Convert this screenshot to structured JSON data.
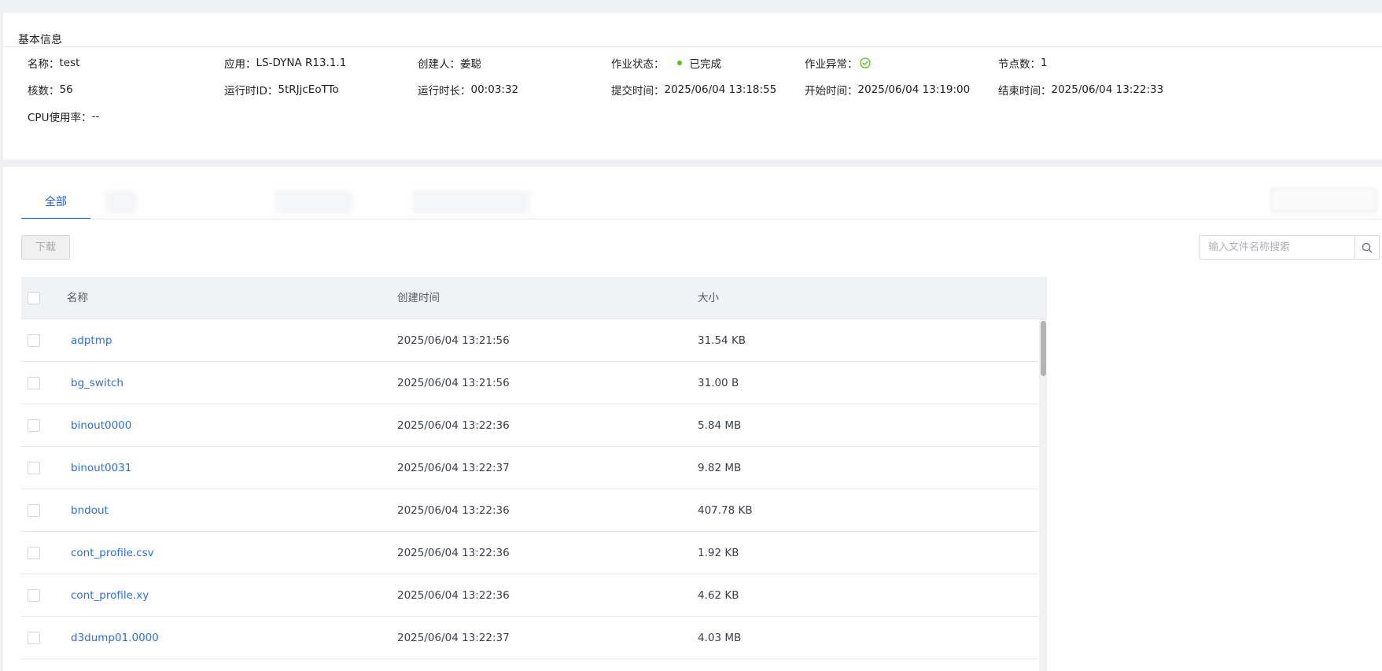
{
  "basic_info": {
    "title": "基本信息",
    "fields": {
      "name": {
        "label": "名称：",
        "value": "test"
      },
      "app": {
        "label": "应用：",
        "value": "LS-DYNA R13.1.1"
      },
      "creator": {
        "label": "创建人：",
        "value": "姜聪"
      },
      "job_status": {
        "label": "作业状态：",
        "value": "已完成"
      },
      "job_error": {
        "label": "作业异常："
      },
      "node_count": {
        "label": "节点数：",
        "value": "1"
      },
      "cores": {
        "label": "核数：",
        "value": "56"
      },
      "run_id": {
        "label": "运行时ID：",
        "value": "5tRJjcEoTTo"
      },
      "run_duration": {
        "label": "运行时长：",
        "value": "00:03:32"
      },
      "submit_time": {
        "label": "提交时间：",
        "value": "2025/06/04 13:18:55"
      },
      "start_time": {
        "label": "开始时间：",
        "value": "2025/06/04 13:19:00"
      },
      "end_time": {
        "label": "结束时间：",
        "value": "2025/06/04 13:22:33"
      },
      "cpu_usage": {
        "label": "CPU使用率：",
        "value": "--"
      }
    }
  },
  "tabs": {
    "active": "全部"
  },
  "toolbar": {
    "download_label": "下载",
    "search_placeholder": "输入文件名称搜索"
  },
  "table": {
    "columns": {
      "name": "名称",
      "created": "创建时间",
      "size": "大小"
    },
    "rows": [
      {
        "name": "adptmp",
        "created": "2025/06/04 13:21:56",
        "size": "31.54 KB"
      },
      {
        "name": "bg_switch",
        "created": "2025/06/04 13:21:56",
        "size": "31.00 B"
      },
      {
        "name": "binout0000",
        "created": "2025/06/04 13:22:36",
        "size": "5.84 MB"
      },
      {
        "name": "binout0031",
        "created": "2025/06/04 13:22:37",
        "size": "9.82 MB"
      },
      {
        "name": "bndout",
        "created": "2025/06/04 13:22:36",
        "size": "407.78 KB"
      },
      {
        "name": "cont_profile.csv",
        "created": "2025/06/04 13:22:36",
        "size": "1.92 KB"
      },
      {
        "name": "cont_profile.xy",
        "created": "2025/06/04 13:22:36",
        "size": "4.62 KB"
      },
      {
        "name": "d3dump01.0000",
        "created": "2025/06/04 13:22:37",
        "size": "4.03 MB"
      }
    ]
  },
  "colors": {
    "accent": "#1e5ad8",
    "link": "#2e6fd9",
    "status_ok": "#52c41a"
  },
  "icons": {
    "status_dot": "green-dot-icon",
    "job_error": "check-circle-icon",
    "search": "search-icon"
  }
}
